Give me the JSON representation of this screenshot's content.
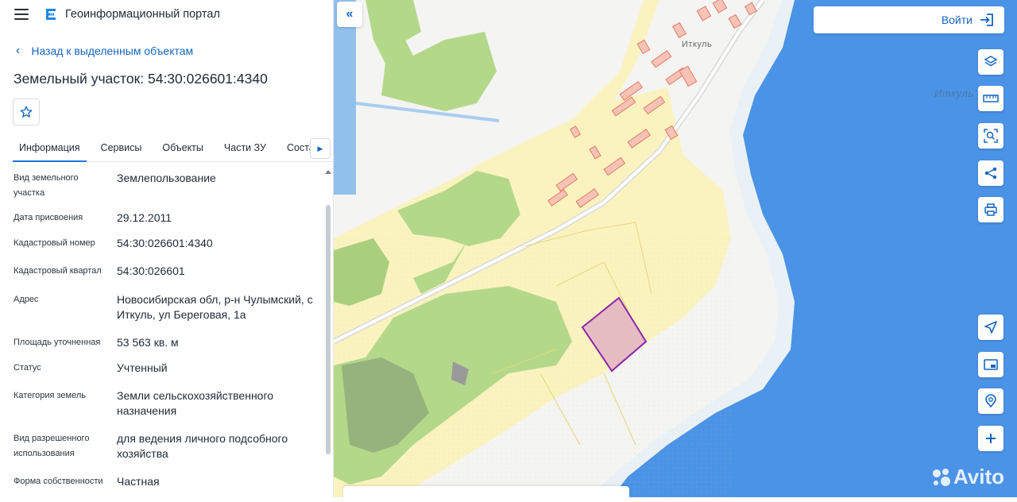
{
  "app": {
    "title": "Геоинформационный портал"
  },
  "nav": {
    "back_label": "Назад к выделенным объектам"
  },
  "parcel": {
    "title": "Земельный участок: 54:30:026601:4340"
  },
  "tabs": [
    "Информация",
    "Сервисы",
    "Объекты",
    "Части ЗУ",
    "Состав"
  ],
  "properties": [
    {
      "label": "Вид земельного участка",
      "value": "Землепользование"
    },
    {
      "label": "Дата присвоения",
      "value": "29.12.2011"
    },
    {
      "label": "Кадастровый номер",
      "value": "54:30:026601:4340"
    },
    {
      "label": "Кадастровый квартал",
      "value": "54:30:026601"
    },
    {
      "label": "Адрес",
      "value": "Новосибирская обл, р-н Чулымский, с Иткуль, ул Береговая, 1а"
    },
    {
      "label": "Площадь уточненная",
      "value": "53 563 кв. м"
    },
    {
      "label": "Статус",
      "value": "Учтенный"
    },
    {
      "label": "Категория земель",
      "value": "Земли сельскохозяйственного назначения"
    },
    {
      "label": "Вид разрешенного использования",
      "value": "для ведения личного подсобного хозяйства"
    },
    {
      "label": "Форма собственности",
      "value": "Частная"
    }
  ],
  "header_right": {
    "login_label": "Войти"
  },
  "map": {
    "labels": {
      "town": "Иткуль",
      "lake": "Иткуль"
    },
    "colors": {
      "water": "#4b93e6",
      "land": "#f4f4f2",
      "fields": "#fbf3bf",
      "forest": "#b4d88a",
      "parcel_fill": "#e6bcc3",
      "parcel_border": "#8e24aa",
      "buildings": "#f1a08f"
    }
  },
  "toolbar_icons": [
    "layers-icon",
    "ruler-icon",
    "search-area-icon",
    "share-icon",
    "print-icon",
    "locate-icon",
    "minimap-icon",
    "pin-search-icon",
    "zoom-in-icon"
  ],
  "watermark": {
    "text": "Avito"
  }
}
